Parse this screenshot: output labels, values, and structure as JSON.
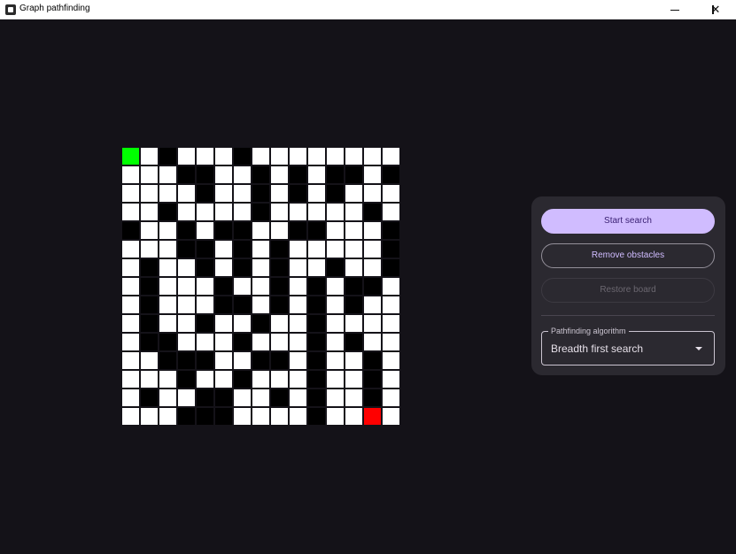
{
  "window": {
    "title": "Graph pathfinding",
    "minimize_glyph": "",
    "maximize_glyph": "",
    "close_glyph": "✕"
  },
  "board": {
    "rows": 15,
    "cols": 15,
    "colors": {
      "empty": "#ffffff",
      "wall": "#000000",
      "start": "#00ff00",
      "end": "#ff0000"
    },
    "cells": [
      "S.#...#........",
      "...##..#.#.##.#",
      "....#..#.#.#...",
      "..#....#.....#.",
      "#..#.##..##...#",
      "...##.#.#.....#",
      ".#..#.#.#..#..#",
      ".#...#..#.#.##.",
      ".#...##.#.#.#..",
      ".#..#..#..#....",
      ".##...#...#.#..",
      "..###..##.#..#.",
      "...#..#...#..#.",
      ".#..##..#.#..#.",
      "...###....#..E."
    ]
  },
  "panel": {
    "start_label": "Start search",
    "remove_label": "Remove obstacles",
    "restore_label": "Restore board",
    "algorithm": {
      "label": "Pathfinding algorithm",
      "value": "Breadth first search"
    }
  }
}
